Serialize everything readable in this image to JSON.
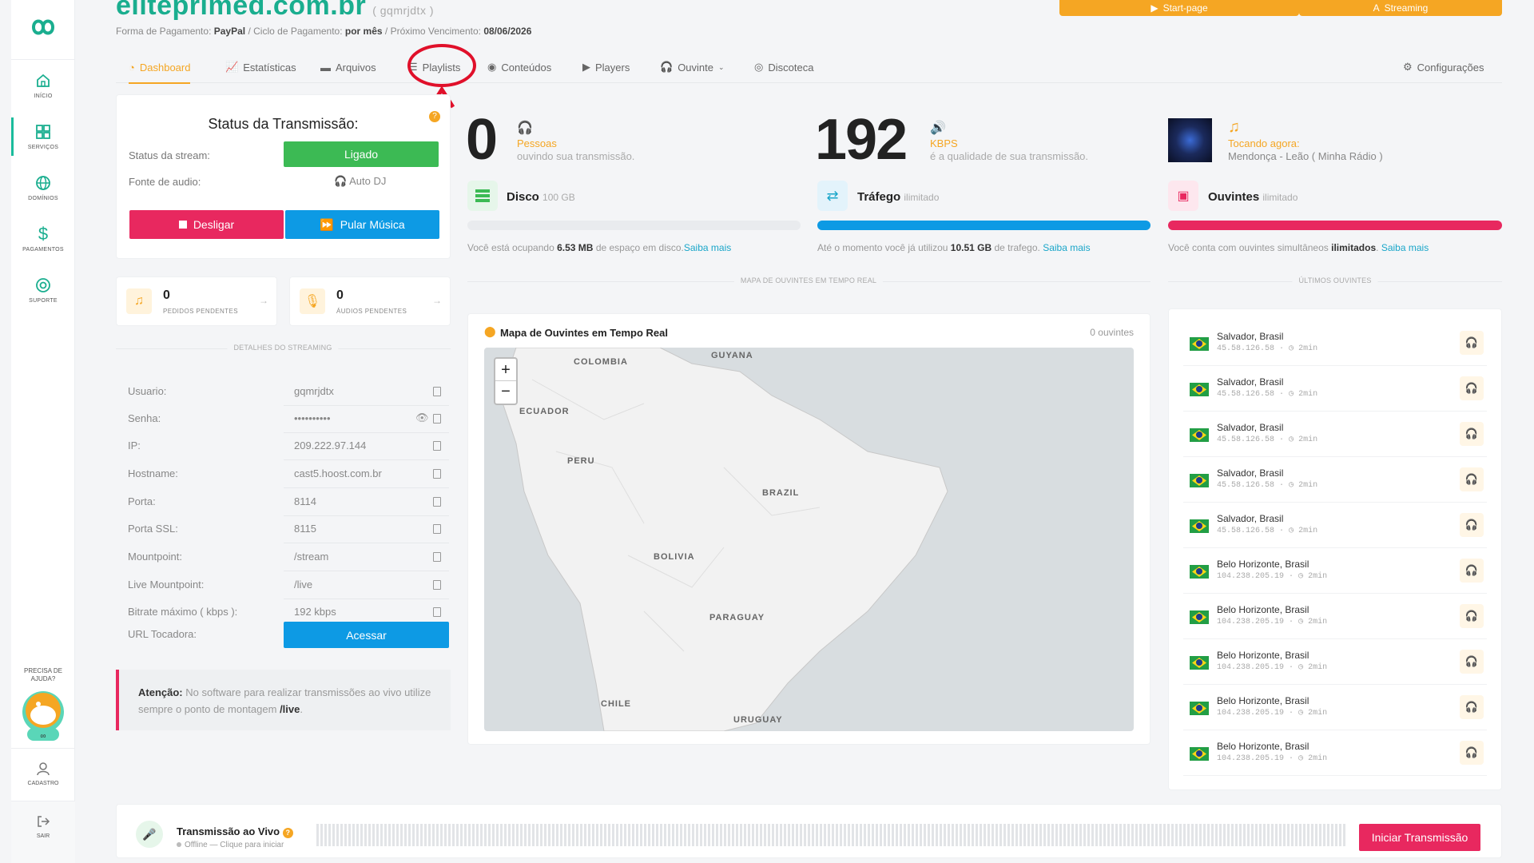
{
  "header": {
    "site": "eliteprimed.com.br",
    "user_tag": "( gqmrjdtx )",
    "payment_label": "Forma de Pagamento:",
    "payment_value": "PayPal",
    "cycle_label": "/ Ciclo de Pagamento:",
    "cycle_value": "por mês",
    "due_label": "/ Próximo Vencimento:",
    "due_value": "08/06/2026",
    "start_page_label": "Start-page",
    "streaming_label": "Streaming"
  },
  "sidebar": {
    "items": [
      {
        "label": "INÍCIO",
        "icon": "home-icon"
      },
      {
        "label": "SERVIÇOS",
        "icon": "grid-icon"
      },
      {
        "label": "DOMÍNIOS",
        "icon": "globe-icon"
      },
      {
        "label": "PAGAMENTOS",
        "icon": "dollar-icon"
      },
      {
        "label": "SUPORTE",
        "icon": "support-icon"
      }
    ],
    "help_line1": "PRECISA DE",
    "help_line2": "AJUDA?",
    "cadastro_label": "CADASTRO",
    "sair_label": "SAIR"
  },
  "tabs": [
    {
      "label": "Dashboard",
      "icon": "dashboard-icon"
    },
    {
      "label": "Estatísticas",
      "icon": "chart-icon"
    },
    {
      "label": "Arquivos",
      "icon": "folder-icon"
    },
    {
      "label": "Playlists",
      "icon": "list-icon"
    },
    {
      "label": "Conteúdos",
      "icon": "podcast-icon"
    },
    {
      "label": "Players",
      "icon": "play-icon"
    },
    {
      "label": "Ouvinte",
      "icon": "headphones-icon"
    },
    {
      "label": "Discoteca",
      "icon": "disc-icon"
    },
    {
      "label": "Configurações",
      "icon": "gear-icon"
    }
  ],
  "status": {
    "title": "Status da Transmissão:",
    "stream_label": "Status da stream:",
    "stream_value": "Ligado",
    "source_label": "Fonte de audio:",
    "source_value": "Auto DJ",
    "off_button": "Desligar",
    "skip_button": "Pular Música"
  },
  "pending": {
    "requests_count": "0",
    "requests_label": "PEDIDOS PENDENTES",
    "audios_count": "0",
    "audios_label": "ÁUDIOS PENDENTES"
  },
  "details": {
    "section_title": "DETALHES DO STREAMING",
    "rows": [
      {
        "label": "Usuario:",
        "value": "gqmrjdtx"
      },
      {
        "label": "Senha:",
        "value": "••••••••••"
      },
      {
        "label": "IP:",
        "value": "209.222.97.144"
      },
      {
        "label": "Hostname:",
        "value": "cast5.hoost.com.br"
      },
      {
        "label": "Porta:",
        "value": "8114"
      },
      {
        "label": "Porta SSL:",
        "value": "8115"
      },
      {
        "label": "Mountpoint:",
        "value": "/stream"
      },
      {
        "label": "Live Mountpoint:",
        "value": "/live"
      },
      {
        "label": "Bitrate máximo ( kbps ):",
        "value": "192 kbps"
      }
    ],
    "url_label": "URL Tocadora:",
    "url_button": "Acessar",
    "warning_bold": "Atenção:",
    "warning_text": "No software para realizar transmissões ao vivo utilize sempre o ponto de montagem",
    "warning_mount": "/live"
  },
  "stats": {
    "listeners_num": "0",
    "listeners_label": "Pessoas",
    "listeners_sub": "ouvindo sua transmissão.",
    "kbps_num": "192",
    "kbps_label": "KBPS",
    "kbps_sub": "é a qualidade de sua transmissão.",
    "now_label": "Tocando agora:",
    "now_value": "Mendonça - Leão ( Minha Rádio )"
  },
  "usage": {
    "disk_title": "Disco",
    "disk_sub": "100 GB",
    "disk_fill": 0.0,
    "disk_pre": "Você está ocupando",
    "disk_value": "6.53 MB",
    "disk_post": "de espaço em disco.",
    "traffic_title": "Tráfego",
    "traffic_sub": "ilimitado",
    "traffic_fill": 1.0,
    "traffic_pre": "Até o momento você já utilizou",
    "traffic_value": "10.51 GB",
    "traffic_post": "de trafego.",
    "listeners_title": "Ouvintes",
    "listeners_sub": "ilimitado",
    "listeners_fill": 1.0,
    "listeners_pre": "Você conta com ouvintes simultâneos",
    "listeners_value": "ilimitados",
    "listeners_post": ".",
    "more_link": "Saiba mais"
  },
  "map": {
    "section_title": "MAPA DE OUVINTES EM TEMPO REAL",
    "title": "Mapa de Ouvintes em Tempo Real",
    "count": "0 ouvintes",
    "zoom_in": "+",
    "zoom_out": "−",
    "labels": [
      "COLOMBIA",
      "GUYANA",
      "ECUADOR",
      "PERU",
      "BRAZIL",
      "BOLIVIA",
      "PARAGUAY",
      "CHILE",
      "URUGUAY"
    ]
  },
  "last_listeners": {
    "section_title": "ÚLTIMOS OUVINTES",
    "items": [
      {
        "city": "Salvador, Brasil",
        "ip": "45.58.126.58",
        "time": "2min"
      },
      {
        "city": "Salvador, Brasil",
        "ip": "45.58.126.58",
        "time": "2min"
      },
      {
        "city": "Salvador, Brasil",
        "ip": "45.58.126.58",
        "time": "2min"
      },
      {
        "city": "Salvador, Brasil",
        "ip": "45.58.126.58",
        "time": "2min"
      },
      {
        "city": "Salvador, Brasil",
        "ip": "45.58.126.58",
        "time": "2min"
      },
      {
        "city": "Belo Horizonte, Brasil",
        "ip": "104.238.205.19",
        "time": "2min"
      },
      {
        "city": "Belo Horizonte, Brasil",
        "ip": "104.238.205.19",
        "time": "2min"
      },
      {
        "city": "Belo Horizonte, Brasil",
        "ip": "104.238.205.19",
        "time": "2min"
      },
      {
        "city": "Belo Horizonte, Brasil",
        "ip": "104.238.205.19",
        "time": "2min"
      },
      {
        "city": "Belo Horizonte, Brasil",
        "ip": "104.238.205.19",
        "time": "2min"
      }
    ]
  },
  "live": {
    "title": "Transmissão ao Vivo",
    "status": "Offline — Clique para iniciar",
    "button": "Iniciar Transmissão"
  },
  "colors": {
    "accent": "#f5a623",
    "brand": "#1aae8f",
    "green": "#3cba54",
    "red": "#e8285f",
    "blue": "#0d9ae4"
  }
}
